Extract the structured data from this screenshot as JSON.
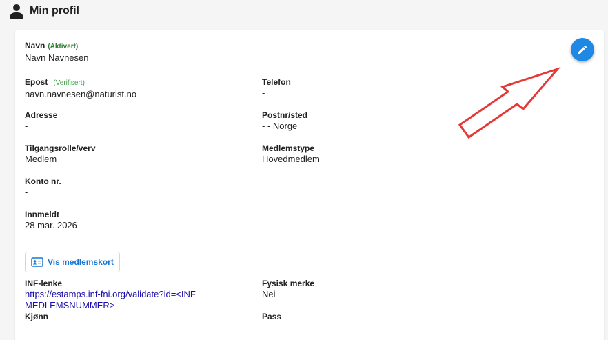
{
  "header": {
    "title": "Min profil"
  },
  "profile": {
    "name": {
      "label": "Navn",
      "status": "(Aktivert)",
      "value": "Navn Navnesen"
    },
    "email": {
      "label": "Epost",
      "status": "(Verifisert)",
      "value": "navn.navnesen@naturist.no"
    },
    "phone": {
      "label": "Telefon",
      "value": "-"
    },
    "address": {
      "label": "Adresse",
      "value": "-"
    },
    "postal": {
      "label": "Postnr/sted",
      "value": "- - Norge"
    },
    "role": {
      "label": "Tilgangsrolle/verv",
      "value": "Medlem"
    },
    "member_type": {
      "label": "Medlemstype",
      "value": "Hovedmedlem"
    },
    "account": {
      "label": "Konto nr.",
      "value": "-"
    },
    "joined": {
      "label": "Innmeldt",
      "value": "28 mar. 2026"
    },
    "inf_link": {
      "label": "INF-lenke",
      "value": "https://estamps.inf-fni.org/validate?id=<INF MEDLEMSNUMMER>"
    },
    "physical_badge": {
      "label": "Fysisk merke",
      "value": "Nei"
    },
    "gender": {
      "label": "Kjønn",
      "value": "-"
    },
    "passport": {
      "label": "Pass",
      "value": "-"
    }
  },
  "actions": {
    "member_card_label": "Vis medlemskort"
  },
  "icons": {
    "edit": "pencil-icon",
    "person": "person-icon",
    "card": "id-card-icon"
  },
  "colors": {
    "accent": "#1e88e5",
    "status_green": "#2e7d32",
    "annotation_arrow": "#e53935"
  }
}
